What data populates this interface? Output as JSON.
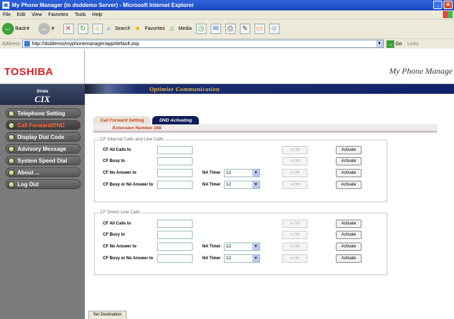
{
  "window": {
    "title": "My Phone Manager (in dsddemo Server) - Microsoft Internet Explorer"
  },
  "menubar": [
    "File",
    "Edit",
    "View",
    "Favorites",
    "Tools",
    "Help"
  ],
  "toolbar": {
    "back": "Back",
    "search": "Search",
    "favorites": "Favorites",
    "media": "Media"
  },
  "addressbar": {
    "label": "Address",
    "url": "http://dsddemo/myphonemanager/app/default.asp",
    "go": "Go",
    "links": "Links"
  },
  "header": {
    "logo": "TOSHIBA",
    "brand": "My Phone Manage",
    "strata_top": "Strata",
    "strata_main": "CIX",
    "tagline": "Optimize Communication"
  },
  "sidebar": {
    "items": [
      {
        "label": "Telephone Setting"
      },
      {
        "label": "Call Forward/DND"
      },
      {
        "label": "Display Dial Code"
      },
      {
        "label": "Advisory Message"
      },
      {
        "label": "System Speed Dial"
      },
      {
        "label": "About ..."
      },
      {
        "label": "Log Out"
      }
    ]
  },
  "tabs": [
    {
      "label": "Call Forward Setting"
    },
    {
      "label": "DND Activating"
    }
  ],
  "extension": "Extension Number 288",
  "groups": [
    {
      "legend": "CF Internal Calls and Line Calls",
      "rows": [
        {
          "label": "CF All Calls to",
          "status": "is Off",
          "button": "Activate"
        },
        {
          "label": "CF Busy to",
          "status": "is Off",
          "button": "Activate"
        },
        {
          "label": "CF No Answer to",
          "na_label": "NA Timer",
          "timer": "12",
          "status": "is Off",
          "button": "Activate"
        },
        {
          "label": "CF Busy or No Answer to",
          "na_label": "NA Timer",
          "timer": "12",
          "status": "is Off",
          "button": "Activate"
        }
      ]
    },
    {
      "legend": "CF Direct Line Calls",
      "rows": [
        {
          "label": "CF All Calls to",
          "status": "is Off",
          "button": "Activate"
        },
        {
          "label": "CF Busy to",
          "status": "is Off",
          "button": "Activate"
        },
        {
          "label": "CF No Answer to",
          "na_label": "NA Timer",
          "timer": "12",
          "status": "is Off",
          "button": "Activate"
        },
        {
          "label": "CF Busy or No Answer to",
          "na_label": "NA Timer",
          "timer": "12",
          "status": "is Off",
          "button": "Activate"
        }
      ]
    }
  ],
  "bottom_tab": "Set Destination",
  "colors": {
    "title_bar": "#1c48c0",
    "logo_red": "#e01b24",
    "banner_navy": "#0a1a4a",
    "tagline_gold": "#f0c040",
    "sidebar_gray": "#7b7b7b",
    "active_orange": "#ff6b3a"
  }
}
